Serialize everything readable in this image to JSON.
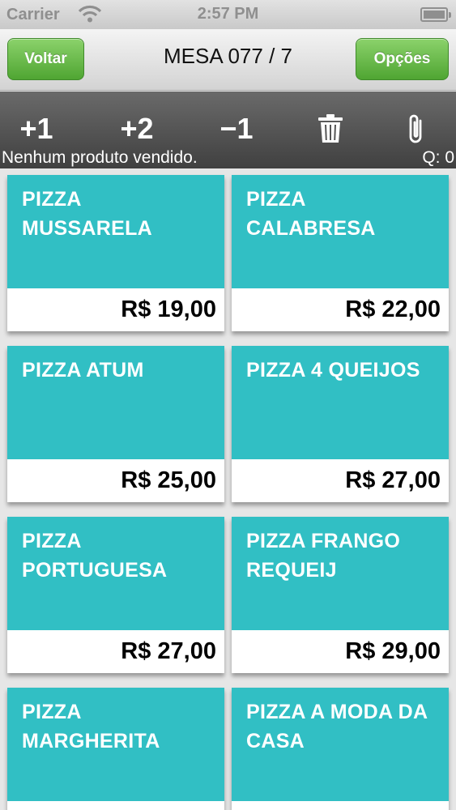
{
  "status_bar": {
    "carrier": "Carrier",
    "time": "2:57 PM",
    "icons": [
      "wifi-icon",
      "battery-icon"
    ]
  },
  "nav": {
    "back_label": "Voltar",
    "title": "MESA 077 / 7",
    "options_label": "Opções",
    "button_color": "#5cb23f"
  },
  "toolbar": {
    "plus1": "+1",
    "plus2": "+2",
    "minus1": "−1",
    "icons": [
      "trash-icon",
      "paperclip-icon"
    ],
    "status_text": "Nenhum produto vendido.",
    "quantity_text": "Q: 0"
  },
  "products": [
    {
      "name": "PIZZA MUSSARELA",
      "price": "R$ 19,00"
    },
    {
      "name": "PIZZA CALABRESA",
      "price": "R$ 22,00"
    },
    {
      "name": "PIZZA ATUM",
      "price": "R$ 25,00"
    },
    {
      "name": "PIZZA 4 QUEIJOS",
      "price": "R$ 27,00"
    },
    {
      "name": "PIZZA PORTUGUESA",
      "price": "R$ 27,00"
    },
    {
      "name": "PIZZA FRANGO REQUEIJ",
      "price": "R$ 29,00"
    },
    {
      "name": "PIZZA MARGHERITA",
      "price": ""
    },
    {
      "name": "PIZZA A MODA DA CASA",
      "price": ""
    }
  ],
  "colors": {
    "card": "#31bfc4",
    "toolbar": "#4a4a4a"
  }
}
